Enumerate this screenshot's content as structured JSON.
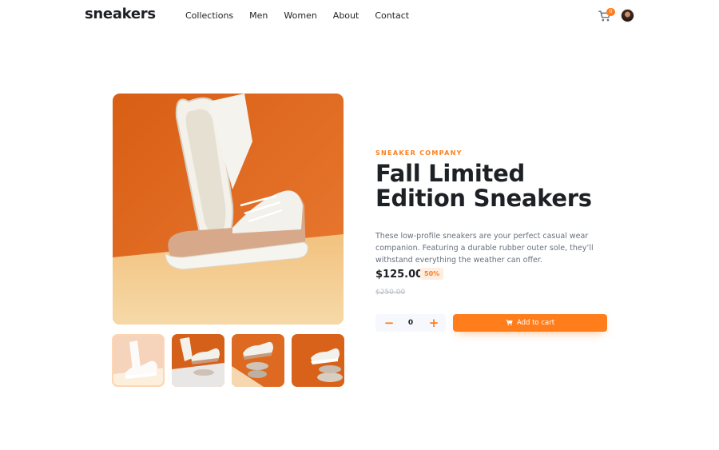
{
  "header": {
    "logo": "sneakers",
    "nav": [
      "Collections",
      "Men",
      "Women",
      "About",
      "Contact"
    ],
    "cart_count": "0",
    "icons": {
      "cart": "cart-icon",
      "avatar": "avatar"
    }
  },
  "product": {
    "company": "SNEAKER COMPANY",
    "title": "Fall Limited Edition Sneakers",
    "description": "These low-profile sneakers are your perfect casual wear companion. Featuring a durable rubber outer sole, they’ll withstand everything the weather can offer.",
    "price": "$125.00",
    "discount": "50%",
    "old_price": "$250.00"
  },
  "cart_controls": {
    "minus": "−",
    "quantity": "0",
    "plus": "+",
    "add_label": "Add to cart"
  },
  "colors": {
    "accent": "#ff7e1b",
    "accent_pale": "#ffede0",
    "text_dark": "#1d2025",
    "text_gray": "#68707d"
  }
}
